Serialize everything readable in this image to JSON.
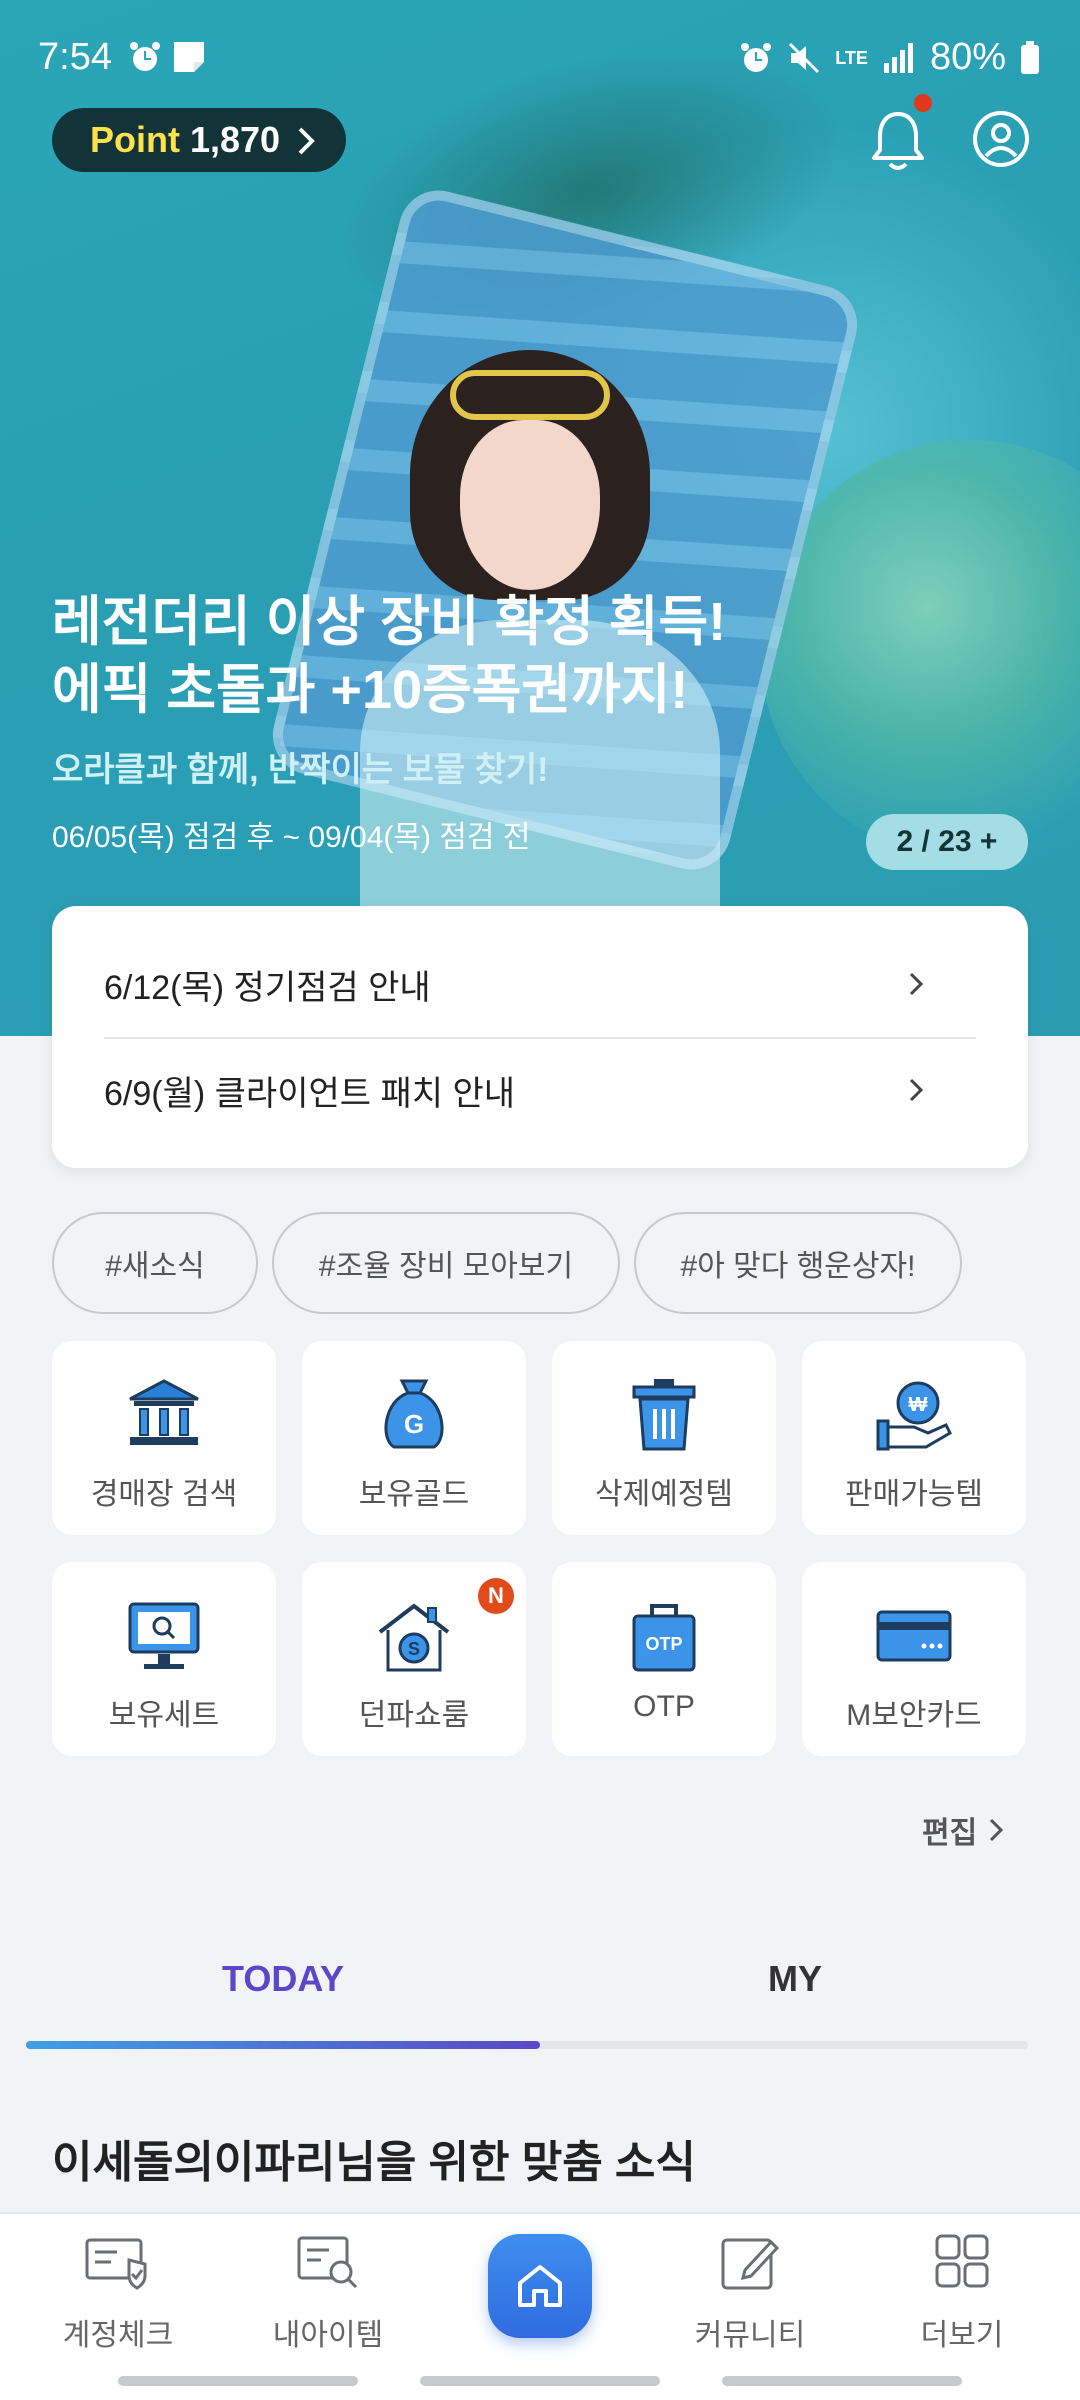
{
  "status_bar": {
    "time": "7:54",
    "battery": "80%",
    "network": "LTE"
  },
  "header": {
    "point_label": "Point",
    "point_value": "1,870"
  },
  "hero": {
    "title_line1": "레전더리 이상 장비 확정 획득!",
    "title_line2": "에픽 초돌과 +10증폭권까지!",
    "subtitle": "오라클과 함께, 반짝이는 보물 찾기!",
    "date": "06/05(목) 점검 후 ~ 09/04(목) 점검 전",
    "page_indicator": "2 / 23 +"
  },
  "notices": [
    {
      "label": "6/12(목) 정기점검 안내"
    },
    {
      "label": "6/9(월) 클라이언트 패치 안내"
    }
  ],
  "tags": [
    "#새소식",
    "#조율 장비 모아보기",
    "#아 맞다 행운상자!"
  ],
  "tiles": [
    {
      "label": "경매장 검색",
      "icon": "auction-bank-icon"
    },
    {
      "label": "보유골드",
      "icon": "gold-bag-icon",
      "icon_text": "G"
    },
    {
      "label": "삭제예정템",
      "icon": "trash-icon"
    },
    {
      "label": "판매가능템",
      "icon": "sell-hand-icon"
    },
    {
      "label": "보유세트",
      "icon": "monitor-search-icon"
    },
    {
      "label": "던파쇼룸",
      "icon": "showroom-house-icon",
      "badge": "N",
      "icon_text": "S"
    },
    {
      "label": "OTP",
      "icon": "otp-bag-icon",
      "icon_text": "OTP"
    },
    {
      "label": "M보안카드",
      "icon": "security-card-icon"
    }
  ],
  "edit_label": "편집",
  "tabs": {
    "today": "TODAY",
    "my": "MY"
  },
  "section_title": "이세돌의이파리님을 위한 맞춤 소식",
  "bottom_nav": [
    {
      "label": "계정체크",
      "icon": "account-check-icon"
    },
    {
      "label": "내아이템",
      "icon": "my-item-icon"
    },
    {
      "label": "",
      "icon": "home-icon"
    },
    {
      "label": "커뮤니티",
      "icon": "community-edit-icon"
    },
    {
      "label": "더보기",
      "icon": "more-grid-icon"
    }
  ],
  "colors": {
    "hero_bg": "#2aa6b8",
    "accent_purple": "#5a48c8",
    "home_blue": "#2f6be0",
    "badge_red": "#e24a1c",
    "point_yellow": "#ffe24a"
  }
}
